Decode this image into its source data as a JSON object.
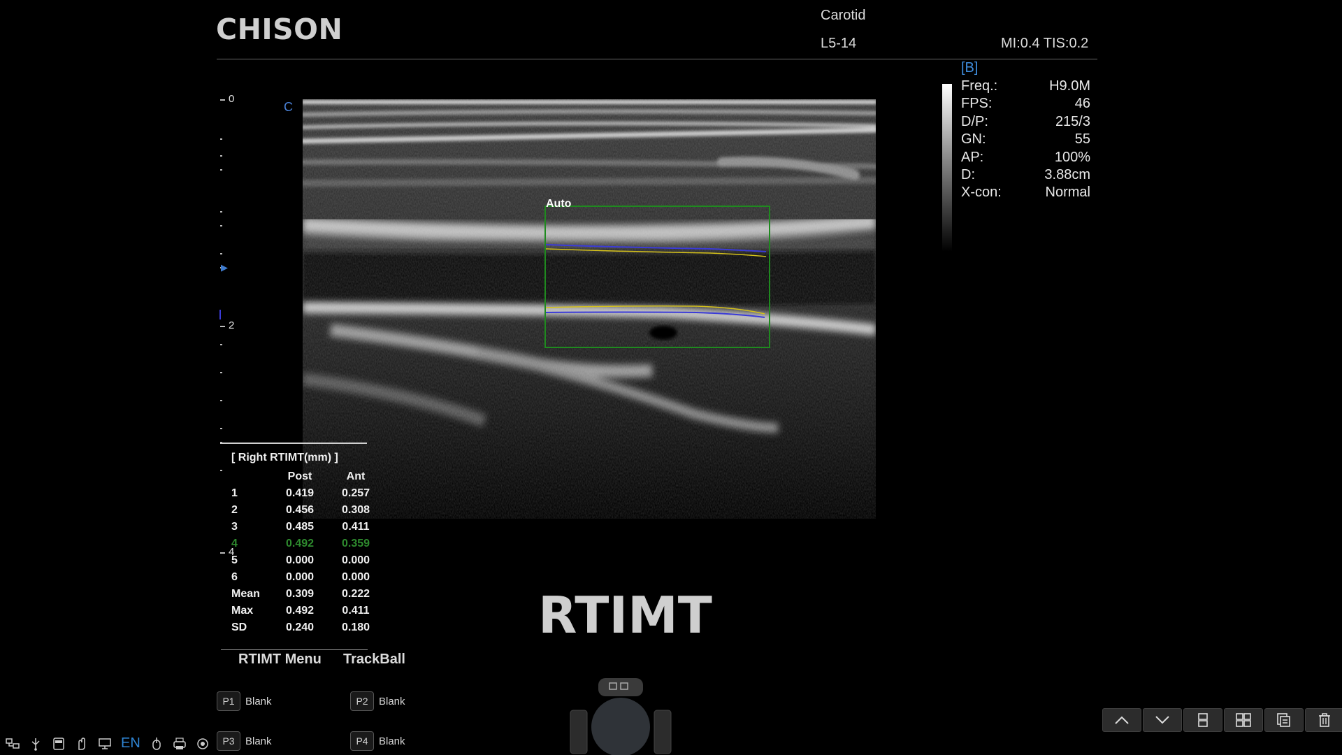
{
  "header": {
    "logo": "CHISON",
    "preset": "Carotid",
    "probe": "L5-14",
    "indices": "MI:0.4 TIS:0.2"
  },
  "imaging_params": {
    "mode": "[B]",
    "rows": [
      {
        "label": "Freq.:",
        "value": "H9.0M"
      },
      {
        "label": "FPS:",
        "value": "46"
      },
      {
        "label": "D/P:",
        "value": "215/3"
      },
      {
        "label": "GN:",
        "value": "55"
      },
      {
        "label": "AP:",
        "value": "100%"
      },
      {
        "label": "D:",
        "value": "3.88cm"
      },
      {
        "label": "X-con:",
        "value": "Normal"
      }
    ]
  },
  "depth_scale": {
    "labels": [
      "0",
      "2",
      "4"
    ],
    "orientation_marker": "C"
  },
  "image": {
    "roi_label": "Auto"
  },
  "results": {
    "title": "[ Right RTIMT(mm) ]",
    "columns": [
      "",
      "Post",
      "Ant"
    ],
    "rows": [
      {
        "label": "1",
        "post": "0.419",
        "ant": "0.257"
      },
      {
        "label": "2",
        "post": "0.456",
        "ant": "0.308"
      },
      {
        "label": "3",
        "post": "0.485",
        "ant": "0.411"
      },
      {
        "label": "4",
        "post": "0.492",
        "ant": "0.359"
      },
      {
        "label": "5",
        "post": "0.000",
        "ant": "0.000"
      },
      {
        "label": "6",
        "post": "0.000",
        "ant": "0.000"
      },
      {
        "label": "Mean",
        "post": "0.309",
        "ant": "0.222"
      },
      {
        "label": "Max",
        "post": "0.492",
        "ant": "0.411"
      },
      {
        "label": "SD",
        "post": "0.240",
        "ant": "0.180"
      }
    ],
    "active_row": "4"
  },
  "mode_title": "RTIMT",
  "menu": {
    "left_title": "RTIMT Menu",
    "right_title": "TrackBall"
  },
  "presets": [
    {
      "key": "P1",
      "label": "Blank"
    },
    {
      "key": "P2",
      "label": "Blank"
    },
    {
      "key": "P3",
      "label": "Blank"
    },
    {
      "key": "P4",
      "label": "Blank"
    }
  ],
  "status_bar": {
    "language": "EN",
    "icons": [
      "network-icon",
      "usb-icon",
      "disk-icon",
      "hand-icon",
      "monitor-icon",
      "mouse-icon",
      "printer-icon",
      "speaker-icon"
    ]
  },
  "toolbar": {
    "buttons": [
      "up-arrow-icon",
      "down-arrow-icon",
      "dual-layout-icon",
      "quad-layout-icon",
      "report-icon",
      "trash-icon"
    ]
  },
  "colors": {
    "accent_blue": "#3f8fe0",
    "roi_green": "#1f8a1f",
    "trace_yellow": "#d6c21a",
    "trace_blue": "#3b3bd8",
    "active_row_green": "#2e8b2e"
  }
}
